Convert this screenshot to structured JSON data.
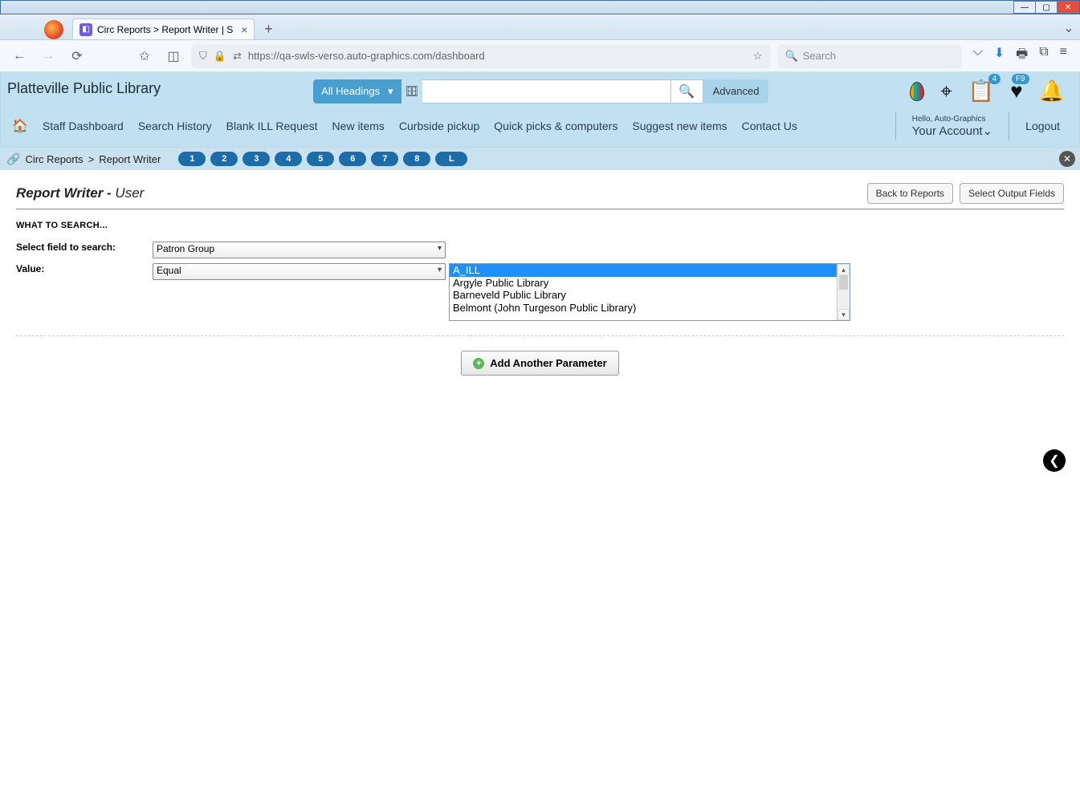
{
  "browser": {
    "tab_title": "Circ Reports > Report Writer | S",
    "url": "https://qa-swls-verso.auto-graphics.com/dashboard",
    "search_placeholder": "Search"
  },
  "header": {
    "library_name": "Platteville Public Library",
    "headings_label": "All Headings",
    "advanced": "Advanced",
    "greeting": "Hello, Auto-Graphics",
    "account": "Your Account",
    "logout": "Logout",
    "badges": {
      "list": "4",
      "heart": "F9"
    }
  },
  "nav": {
    "items": [
      "Staff Dashboard",
      "Search History",
      "Blank ILL Request",
      "New items",
      "Curbside pickup",
      "Quick picks & computers",
      "Suggest new items",
      "Contact Us"
    ]
  },
  "breadcrumb": {
    "a": "Circ Reports",
    "sep": ">",
    "b": "Report Writer",
    "steps": [
      "1",
      "2",
      "3",
      "4",
      "5",
      "6",
      "7",
      "8",
      "L"
    ]
  },
  "page": {
    "title_main": "Report Writer - ",
    "title_sub": "User",
    "back_btn": "Back to Reports",
    "output_btn": "Select Output Fields",
    "section": "WHAT TO SEARCH...",
    "field_label": "Select field to search:",
    "field_value": "Patron Group",
    "op_label": "Value:",
    "op_value": "Equal",
    "options": [
      "A_ILL",
      "Argyle Public Library",
      "Barneveld Public Library",
      "Belmont (John Turgeson Public Library)"
    ],
    "add_param": "Add Another Parameter"
  }
}
